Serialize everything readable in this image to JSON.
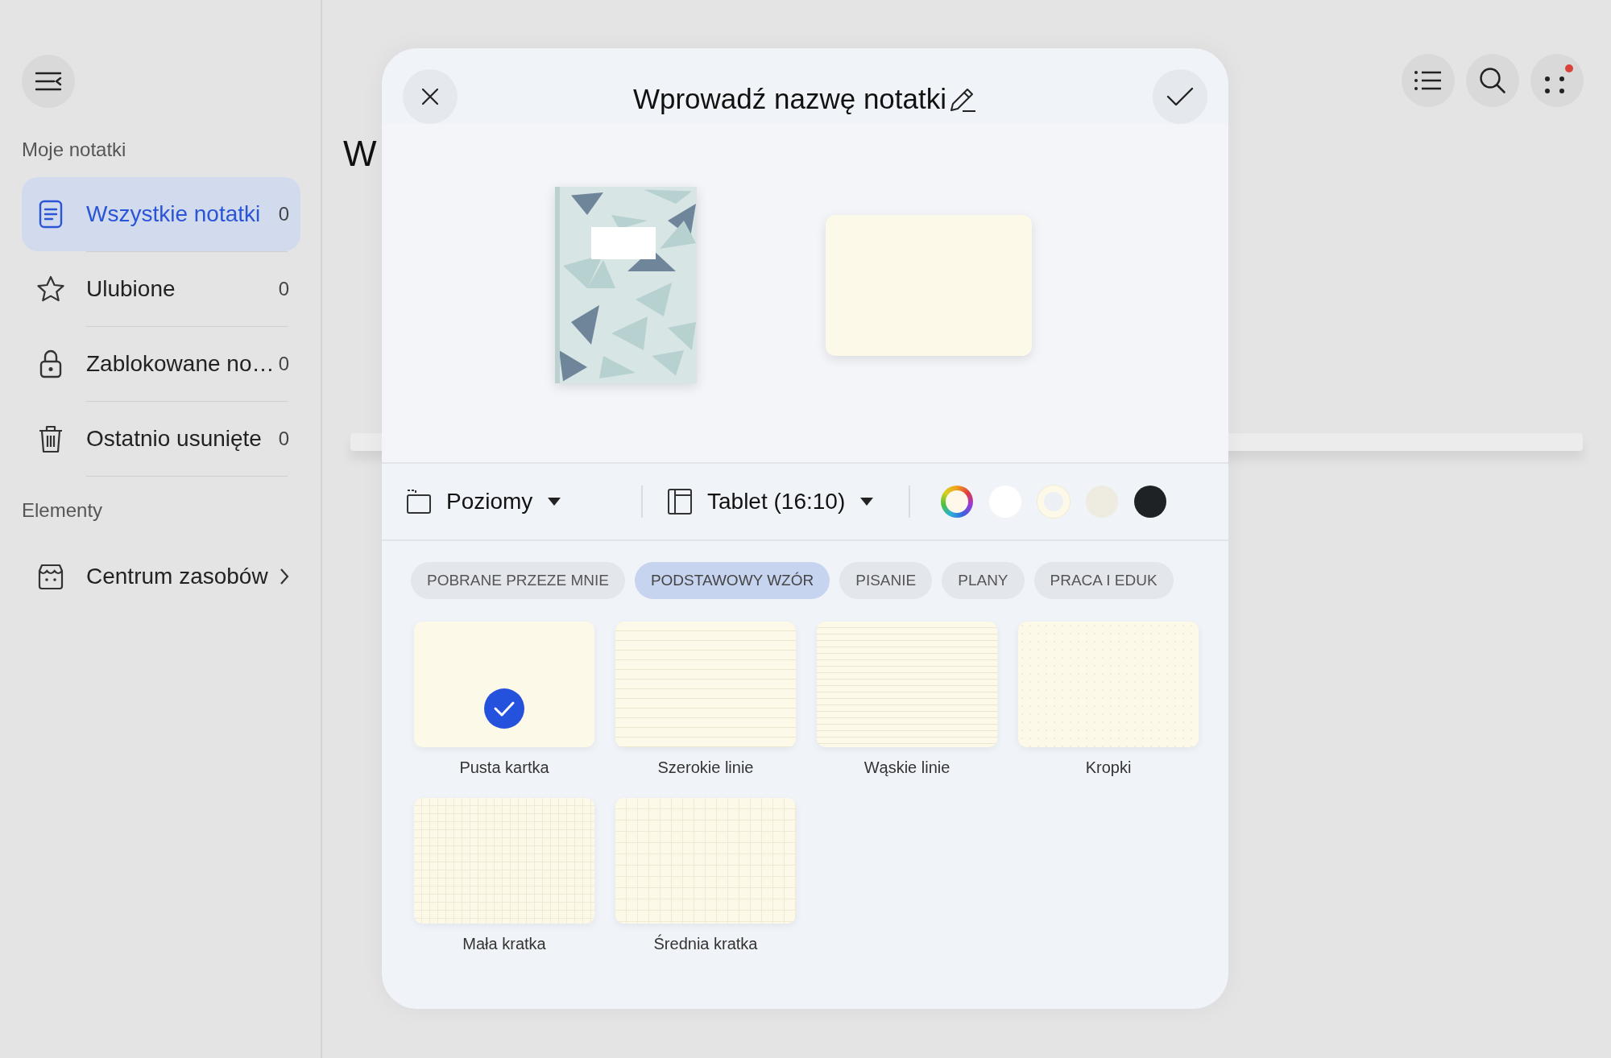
{
  "sidebar": {
    "section_title": "Moje notatki",
    "items": [
      {
        "kind": "notes",
        "label": "Wszystkie notatki",
        "count": "0",
        "selected": true
      },
      {
        "kind": "star",
        "label": "Ulubione",
        "count": "0",
        "selected": false
      },
      {
        "kind": "lock",
        "label": "Zablokowane no…",
        "count": "0",
        "selected": false
      },
      {
        "kind": "trash",
        "label": "Ostatnio usunięte",
        "count": "0",
        "selected": false
      }
    ],
    "elements_title": "Elementy",
    "resource_center": {
      "label": "Centrum zasobów"
    }
  },
  "background": {
    "heading": "W"
  },
  "dialog": {
    "title": "Wprowadź nazwę notatki",
    "orientation": {
      "value": "Poziomy"
    },
    "size": {
      "value": "Tablet (16:10)"
    },
    "colors": [
      {
        "kind": "custom",
        "color": "#fdf8ea",
        "selected": false
      },
      {
        "kind": "swatch",
        "color": "#ffffff",
        "selected": false
      },
      {
        "kind": "swatch",
        "color": "#fdf9e9",
        "selected": true
      },
      {
        "kind": "swatch",
        "color": "#eeebe0",
        "selected": false
      },
      {
        "kind": "swatch",
        "color": "#1f2225",
        "selected": false
      }
    ],
    "tabs": [
      {
        "label": "POBRANE PRZEZE MNIE",
        "selected": false
      },
      {
        "label": "PODSTAWOWY WZÓR",
        "selected": true
      },
      {
        "label": "PISANIE",
        "selected": false
      },
      {
        "label": "PLANY",
        "selected": false
      },
      {
        "label": "PRACA I EDUK",
        "selected": false
      }
    ],
    "templates": [
      {
        "kind": "blank",
        "label": "Pusta kartka",
        "selected": true
      },
      {
        "kind": "wide_lines",
        "label": "Szerokie linie",
        "selected": false
      },
      {
        "kind": "narrow_lines",
        "label": "Wąskie linie",
        "selected": false
      },
      {
        "kind": "dots",
        "label": "Kropki",
        "selected": false
      },
      {
        "kind": "small_grid",
        "label": "Mała kratka",
        "selected": false
      },
      {
        "kind": "medium_grid",
        "label": "Średnia kratka",
        "selected": false
      }
    ]
  }
}
